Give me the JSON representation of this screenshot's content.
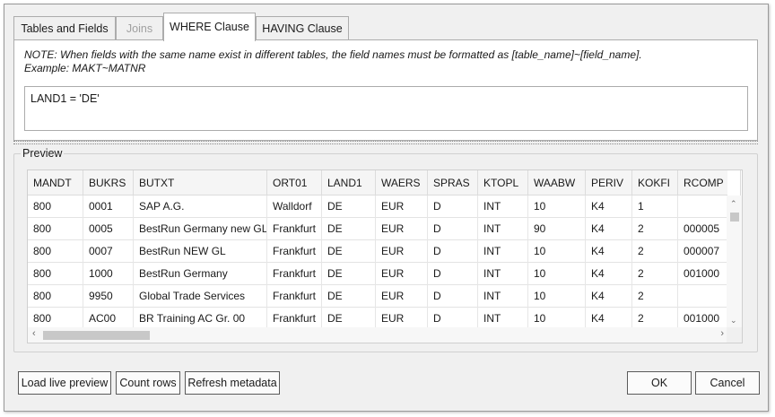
{
  "tabs": [
    {
      "label": "Tables and Fields",
      "state": "normal"
    },
    {
      "label": "Joins",
      "state": "disabled"
    },
    {
      "label": "WHERE Clause",
      "state": "active"
    },
    {
      "label": "HAVING Clause",
      "state": "normal"
    }
  ],
  "where": {
    "note_line1": "NOTE: When fields with the same name exist in different tables, the field names must be formatted as [table_name]~[field_name].",
    "note_line2": "Example: MAKT~MATNR",
    "clause_value": "LAND1 = 'DE'"
  },
  "preview": {
    "title": "Preview",
    "columns": [
      "MANDT",
      "BUKRS",
      "BUTXT",
      "ORT01",
      "LAND1",
      "WAERS",
      "SPRAS",
      "KTOPL",
      "WAABW",
      "PERIV",
      "KOKFI",
      "RCOMP"
    ],
    "rows": [
      [
        "800",
        "0001",
        "SAP A.G.",
        "Walldorf",
        "DE",
        "EUR",
        "D",
        "INT",
        "10",
        "K4",
        "1",
        ""
      ],
      [
        "800",
        "0005",
        "BestRun Germany new GL",
        "Frankfurt",
        "DE",
        "EUR",
        "D",
        "INT",
        "90",
        "K4",
        "2",
        "000005"
      ],
      [
        "800",
        "0007",
        "BestRun NEW GL",
        "Frankfurt",
        "DE",
        "EUR",
        "D",
        "INT",
        "10",
        "K4",
        "2",
        "000007"
      ],
      [
        "800",
        "1000",
        "BestRun Germany",
        "Frankfurt",
        "DE",
        "EUR",
        "D",
        "INT",
        "10",
        "K4",
        "2",
        "001000"
      ],
      [
        "800",
        "9950",
        "Global Trade Services",
        "Frankfurt",
        "DE",
        "EUR",
        "D",
        "INT",
        "10",
        "K4",
        "2",
        ""
      ],
      [
        "800",
        "AC00",
        "BR Training AC Gr. 00",
        "Frankfurt",
        "DE",
        "EUR",
        "D",
        "INT",
        "10",
        "K4",
        "2",
        "001000"
      ]
    ]
  },
  "buttons": {
    "load_live_preview": "Load live preview",
    "count_rows": "Count rows",
    "refresh_metadata": "Refresh metadata",
    "ok": "OK",
    "cancel": "Cancel"
  },
  "icons": {
    "scroll_up": "chevron-up-icon",
    "scroll_down": "chevron-down-icon",
    "scroll_left": "chevron-left-icon",
    "scroll_right": "chevron-right-icon"
  }
}
